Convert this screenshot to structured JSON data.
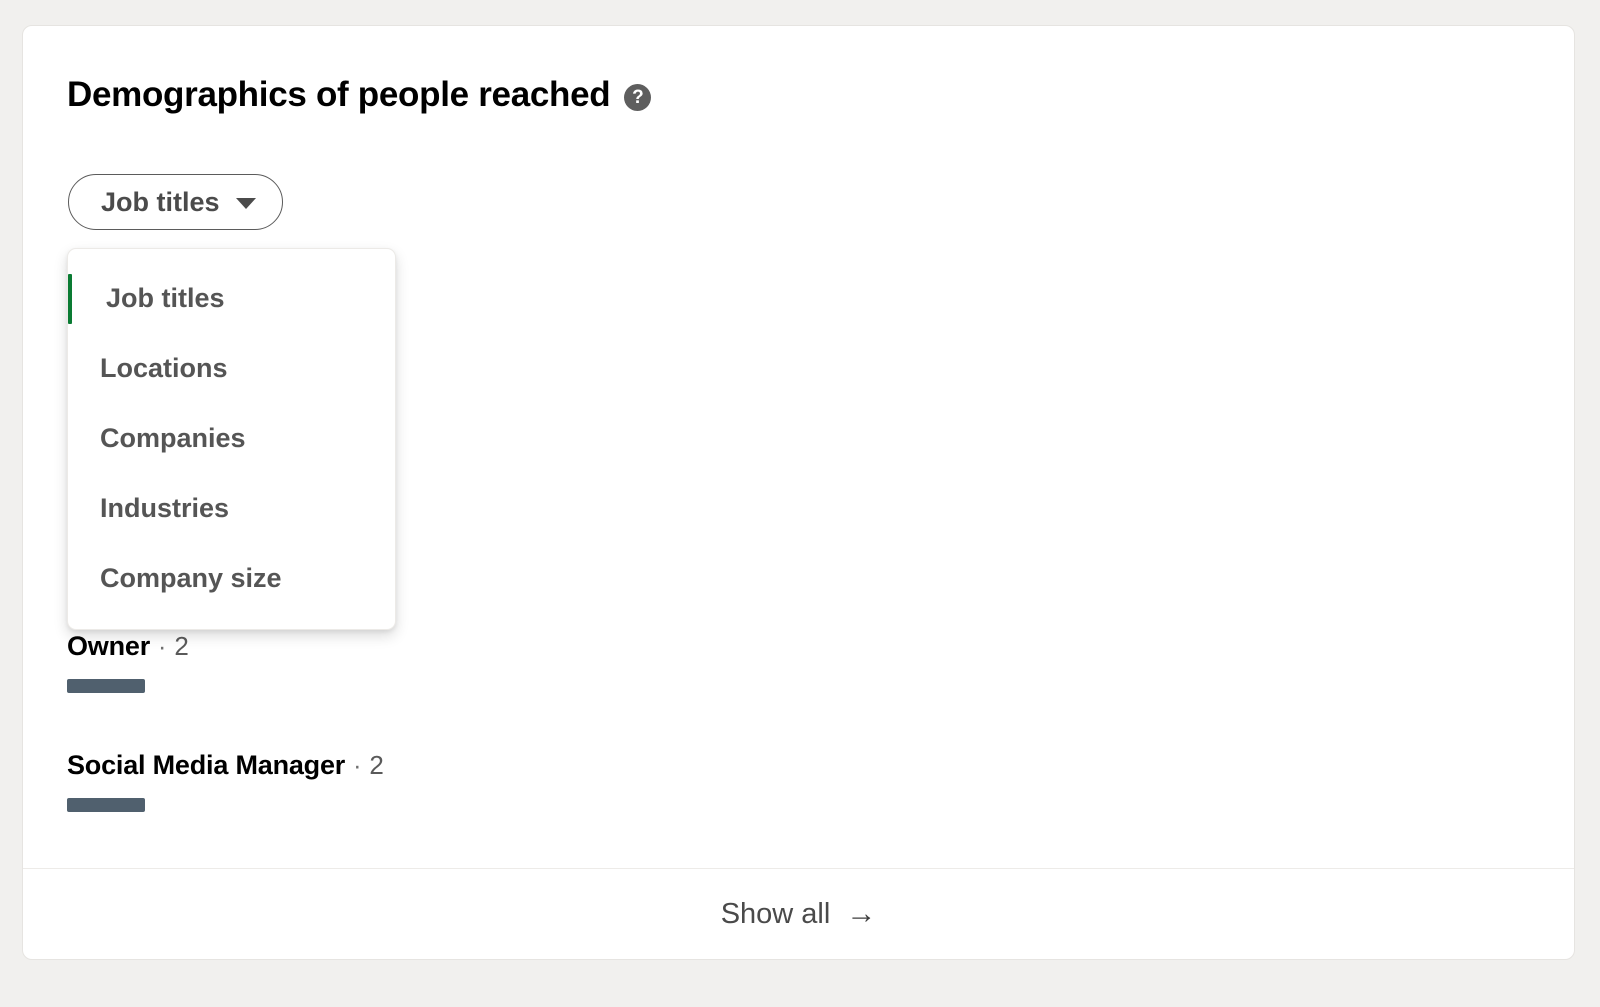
{
  "card": {
    "title": "Demographics of people reached",
    "help_icon": "help-circle-icon",
    "help_glyph": "?"
  },
  "filter": {
    "selected_label": "Job titles",
    "caret_icon": "chevron-down-icon",
    "options": [
      {
        "label": "Job titles",
        "selected": true
      },
      {
        "label": "Locations",
        "selected": false
      },
      {
        "label": "Companies",
        "selected": false
      },
      {
        "label": "Industries",
        "selected": false
      },
      {
        "label": "Company size",
        "selected": false
      }
    ]
  },
  "demographics": {
    "separator": "·",
    "rows": [
      {
        "name": "Owner",
        "count": "2",
        "bar_percent": 5.6
      },
      {
        "name": "Social Media Manager",
        "count": "2",
        "bar_percent": 5.6
      }
    ]
  },
  "footer": {
    "show_all_label": "Show all",
    "arrow_icon": "arrow-right-icon",
    "arrow_glyph": "→"
  },
  "colors": {
    "page_background": "#F1F0EE",
    "card_background": "#FFFFFF",
    "accent_selected": "#0A7B33",
    "bar_fill": "#50606E",
    "divider": "#EDEBE8",
    "title_text": "#000000",
    "muted_text": "#555555"
  }
}
